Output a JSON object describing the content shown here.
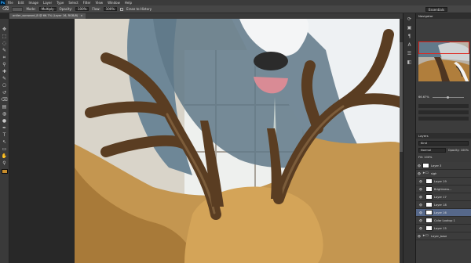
{
  "app": {
    "logo": "Ps"
  },
  "menu": [
    "File",
    "Edit",
    "Image",
    "Layer",
    "Type",
    "Select",
    "Filter",
    "View",
    "Window",
    "Help"
  ],
  "workspace_label": "Essentials",
  "options": {
    "mode_label": "Mode:",
    "mode_value": "Multiply",
    "opacity_label": "Opacity:",
    "opacity_value": "100%",
    "flow_label": "Flow:",
    "flow_value": "100%",
    "erase_label": "Erase to History"
  },
  "document": {
    "tab_title": "antler_ssreward_B @ 66.7% (Layer 16, RGB/8)",
    "close_glyph": "×"
  },
  "icons": {
    "tools": [
      "move-icon",
      "marquee-icon",
      "lasso-icon",
      "quick-select-icon",
      "crop-icon",
      "eyedropper-icon",
      "healing-icon",
      "brush-icon",
      "stamp-icon",
      "history-brush-icon",
      "eraser-icon",
      "gradient-icon",
      "blur-icon",
      "dodge-icon",
      "pen-icon",
      "type-icon",
      "path-select-icon",
      "shape-icon",
      "hand-icon",
      "zoom-icon"
    ],
    "tool_glyphs": [
      "✥",
      "⬚",
      "◌",
      "✎",
      "⌗",
      "⚲",
      "✚",
      "✎",
      "⎔",
      "↺",
      "⌫",
      "▤",
      "◍",
      "●",
      "✒",
      "T",
      "↖",
      "▭",
      "✋",
      "⚲"
    ],
    "dock_glyphs": [
      "⟳",
      "▣",
      "¶",
      "A",
      "☰",
      "◧"
    ],
    "eye": "👁",
    "folder": "▸▭"
  },
  "colors": {
    "foreground": "#c88d2c",
    "accent": "#56688a",
    "nav_frame": "#e0261f"
  },
  "panels": {
    "navigator_tab": "Navigator",
    "zoom_value": "66.67%",
    "layers_tab": "Layers",
    "layers_kind": "Kind",
    "layers_blend": "Normal",
    "layers_opacity": "Opacity: 100%",
    "layers_fill": "Fill: 100%",
    "layers": [
      {
        "name": "Layer 3",
        "thumb": "white",
        "active": false,
        "indent": false
      },
      {
        "name": "sigh",
        "thumb": "folder",
        "active": false,
        "indent": false
      },
      {
        "name": "Layer 19",
        "thumb": "white",
        "active": false,
        "indent": true
      },
      {
        "name": "Brightness...",
        "thumb": "white",
        "active": false,
        "indent": true
      },
      {
        "name": "Layer 17",
        "thumb": "white",
        "active": false,
        "indent": true
      },
      {
        "name": "Layer 18",
        "thumb": "white",
        "active": false,
        "indent": true
      },
      {
        "name": "Layer 16",
        "thumb": "white",
        "active": true,
        "indent": true
      },
      {
        "name": "Color Lookup 1",
        "thumb": "white",
        "active": false,
        "indent": true
      },
      {
        "name": "Layer 15",
        "thumb": "white",
        "active": false,
        "indent": true
      },
      {
        "name": "Layer_base",
        "thumb": "folder",
        "active": false,
        "indent": false
      }
    ]
  }
}
